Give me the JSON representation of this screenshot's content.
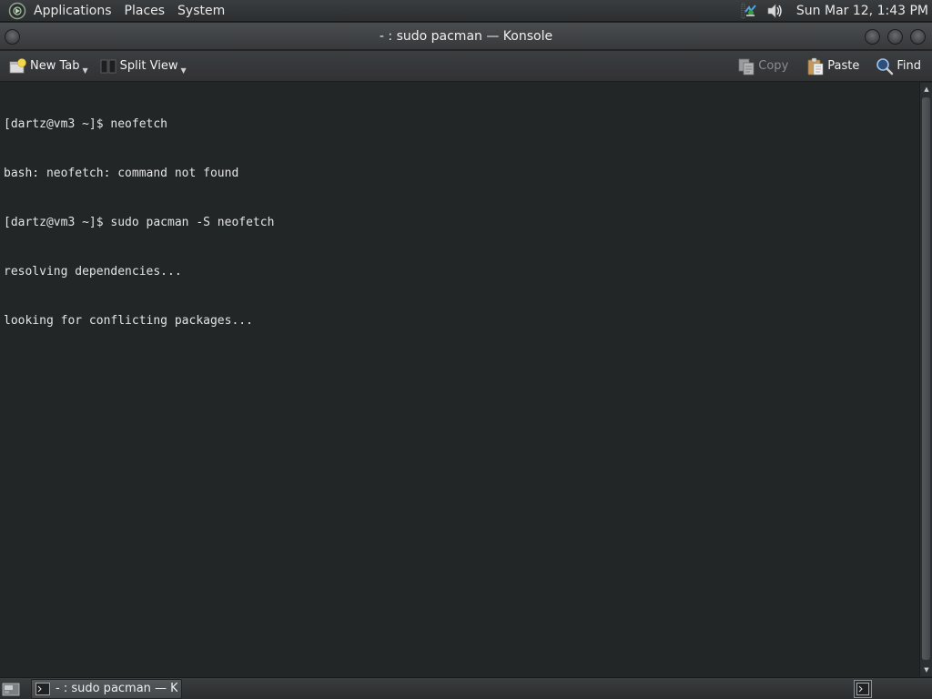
{
  "top_panel": {
    "menus": [
      "Applications",
      "Places",
      "System"
    ],
    "clock": "Sun Mar 12,  1:43 PM"
  },
  "window": {
    "title": "- : sudo pacman — Konsole"
  },
  "toolbar": {
    "new_tab": "New Tab",
    "split_view": "Split View",
    "copy": "Copy",
    "paste": "Paste",
    "find": "Find"
  },
  "terminal": {
    "lines": [
      "[dartz@vm3 ~]$ neofetch",
      "bash: neofetch: command not found",
      "[dartz@vm3 ~]$ sudo pacman -S neofetch",
      "resolving dependencies...",
      "looking for conflicting packages..."
    ]
  },
  "taskbar": {
    "task_label": "- : sudo pacman — K..."
  },
  "icons": {
    "menu": "gnome-foot-icon",
    "network": "network-icon",
    "volume": "speaker-icon",
    "new_tab": "new-tab-icon",
    "split_view": "split-view-icon",
    "copy": "copy-icon",
    "paste": "clipboard-icon",
    "find": "magnifier-icon",
    "terminal": "terminal-icon"
  }
}
